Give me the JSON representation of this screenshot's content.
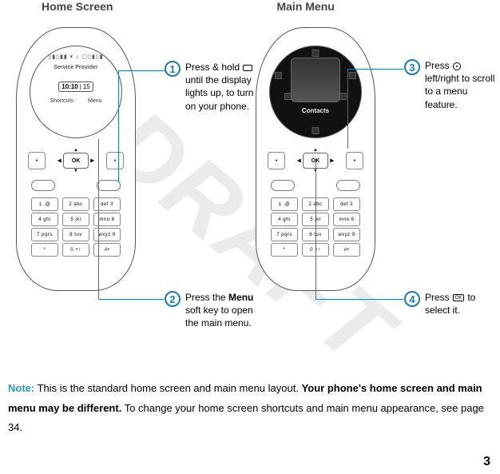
{
  "watermark": "DRAFT",
  "headings": {
    "home": "Home Screen",
    "menu": "Main Menu"
  },
  "phone": {
    "status_icons": "▯▮▯▮▮ ▾ ♪   ▢▯▮▯▮",
    "provider": "Service Provider",
    "time": "10:10",
    "batt": "15",
    "softkey_left": "Shortcuts",
    "softkey_right": "Menu",
    "menu_caption": "Contacts",
    "ok": "OK",
    "nav_side_l": "•",
    "nav_side_r": "•",
    "keys": [
      [
        "1 .@",
        "2 abc",
        "def 3"
      ],
      [
        "4 ghi",
        "5 jkl",
        "mno 6"
      ],
      [
        "7 pqrs",
        "8 tuv",
        "wxyz 9"
      ],
      [
        "*",
        "0 +↑",
        "#•"
      ]
    ]
  },
  "steps": {
    "s1": {
      "num": "1",
      "text_pre": "Press & hold ",
      "text_post": " until the display lights up, to turn on your phone."
    },
    "s2": {
      "num": "2",
      "text_pre": "Press the ",
      "bold": "Menu",
      "text_post": " soft key to open the main menu."
    },
    "s3": {
      "num": "3",
      "text_pre": "Press ",
      "text_post": " left/right to scroll to a menu feature."
    },
    "s4": {
      "num": "4",
      "text_pre": "Press ",
      "ok": "OK",
      "text_post": " to select it."
    }
  },
  "note": {
    "label": "Note:",
    "text1": " This is the standard home screen and main menu layout. ",
    "bold": "Your phone's home screen and main menu may be different.",
    "text2": " To change your home screen shortcuts and main menu appearance, see page 34."
  },
  "page_number": "3"
}
